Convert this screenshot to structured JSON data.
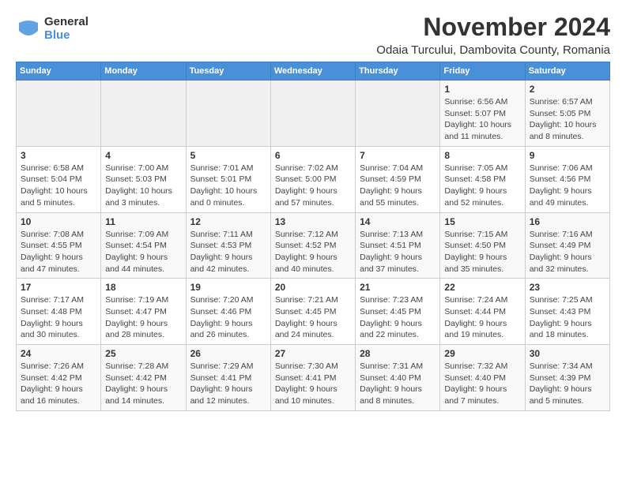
{
  "logo": {
    "general": "General",
    "blue": "Blue"
  },
  "header": {
    "month": "November 2024",
    "location": "Odaia Turcului, Dambovita County, Romania"
  },
  "weekdays": [
    "Sunday",
    "Monday",
    "Tuesday",
    "Wednesday",
    "Thursday",
    "Friday",
    "Saturday"
  ],
  "weeks": [
    [
      {
        "day": "",
        "info": ""
      },
      {
        "day": "",
        "info": ""
      },
      {
        "day": "",
        "info": ""
      },
      {
        "day": "",
        "info": ""
      },
      {
        "day": "",
        "info": ""
      },
      {
        "day": "1",
        "info": "Sunrise: 6:56 AM\nSunset: 5:07 PM\nDaylight: 10 hours and 11 minutes."
      },
      {
        "day": "2",
        "info": "Sunrise: 6:57 AM\nSunset: 5:05 PM\nDaylight: 10 hours and 8 minutes."
      }
    ],
    [
      {
        "day": "3",
        "info": "Sunrise: 6:58 AM\nSunset: 5:04 PM\nDaylight: 10 hours and 5 minutes."
      },
      {
        "day": "4",
        "info": "Sunrise: 7:00 AM\nSunset: 5:03 PM\nDaylight: 10 hours and 3 minutes."
      },
      {
        "day": "5",
        "info": "Sunrise: 7:01 AM\nSunset: 5:01 PM\nDaylight: 10 hours and 0 minutes."
      },
      {
        "day": "6",
        "info": "Sunrise: 7:02 AM\nSunset: 5:00 PM\nDaylight: 9 hours and 57 minutes."
      },
      {
        "day": "7",
        "info": "Sunrise: 7:04 AM\nSunset: 4:59 PM\nDaylight: 9 hours and 55 minutes."
      },
      {
        "day": "8",
        "info": "Sunrise: 7:05 AM\nSunset: 4:58 PM\nDaylight: 9 hours and 52 minutes."
      },
      {
        "day": "9",
        "info": "Sunrise: 7:06 AM\nSunset: 4:56 PM\nDaylight: 9 hours and 49 minutes."
      }
    ],
    [
      {
        "day": "10",
        "info": "Sunrise: 7:08 AM\nSunset: 4:55 PM\nDaylight: 9 hours and 47 minutes."
      },
      {
        "day": "11",
        "info": "Sunrise: 7:09 AM\nSunset: 4:54 PM\nDaylight: 9 hours and 44 minutes."
      },
      {
        "day": "12",
        "info": "Sunrise: 7:11 AM\nSunset: 4:53 PM\nDaylight: 9 hours and 42 minutes."
      },
      {
        "day": "13",
        "info": "Sunrise: 7:12 AM\nSunset: 4:52 PM\nDaylight: 9 hours and 40 minutes."
      },
      {
        "day": "14",
        "info": "Sunrise: 7:13 AM\nSunset: 4:51 PM\nDaylight: 9 hours and 37 minutes."
      },
      {
        "day": "15",
        "info": "Sunrise: 7:15 AM\nSunset: 4:50 PM\nDaylight: 9 hours and 35 minutes."
      },
      {
        "day": "16",
        "info": "Sunrise: 7:16 AM\nSunset: 4:49 PM\nDaylight: 9 hours and 32 minutes."
      }
    ],
    [
      {
        "day": "17",
        "info": "Sunrise: 7:17 AM\nSunset: 4:48 PM\nDaylight: 9 hours and 30 minutes."
      },
      {
        "day": "18",
        "info": "Sunrise: 7:19 AM\nSunset: 4:47 PM\nDaylight: 9 hours and 28 minutes."
      },
      {
        "day": "19",
        "info": "Sunrise: 7:20 AM\nSunset: 4:46 PM\nDaylight: 9 hours and 26 minutes."
      },
      {
        "day": "20",
        "info": "Sunrise: 7:21 AM\nSunset: 4:45 PM\nDaylight: 9 hours and 24 minutes."
      },
      {
        "day": "21",
        "info": "Sunrise: 7:23 AM\nSunset: 4:45 PM\nDaylight: 9 hours and 22 minutes."
      },
      {
        "day": "22",
        "info": "Sunrise: 7:24 AM\nSunset: 4:44 PM\nDaylight: 9 hours and 19 minutes."
      },
      {
        "day": "23",
        "info": "Sunrise: 7:25 AM\nSunset: 4:43 PM\nDaylight: 9 hours and 18 minutes."
      }
    ],
    [
      {
        "day": "24",
        "info": "Sunrise: 7:26 AM\nSunset: 4:42 PM\nDaylight: 9 hours and 16 minutes."
      },
      {
        "day": "25",
        "info": "Sunrise: 7:28 AM\nSunset: 4:42 PM\nDaylight: 9 hours and 14 minutes."
      },
      {
        "day": "26",
        "info": "Sunrise: 7:29 AM\nSunset: 4:41 PM\nDaylight: 9 hours and 12 minutes."
      },
      {
        "day": "27",
        "info": "Sunrise: 7:30 AM\nSunset: 4:41 PM\nDaylight: 9 hours and 10 minutes."
      },
      {
        "day": "28",
        "info": "Sunrise: 7:31 AM\nSunset: 4:40 PM\nDaylight: 9 hours and 8 minutes."
      },
      {
        "day": "29",
        "info": "Sunrise: 7:32 AM\nSunset: 4:40 PM\nDaylight: 9 hours and 7 minutes."
      },
      {
        "day": "30",
        "info": "Sunrise: 7:34 AM\nSunset: 4:39 PM\nDaylight: 9 hours and 5 minutes."
      }
    ]
  ]
}
